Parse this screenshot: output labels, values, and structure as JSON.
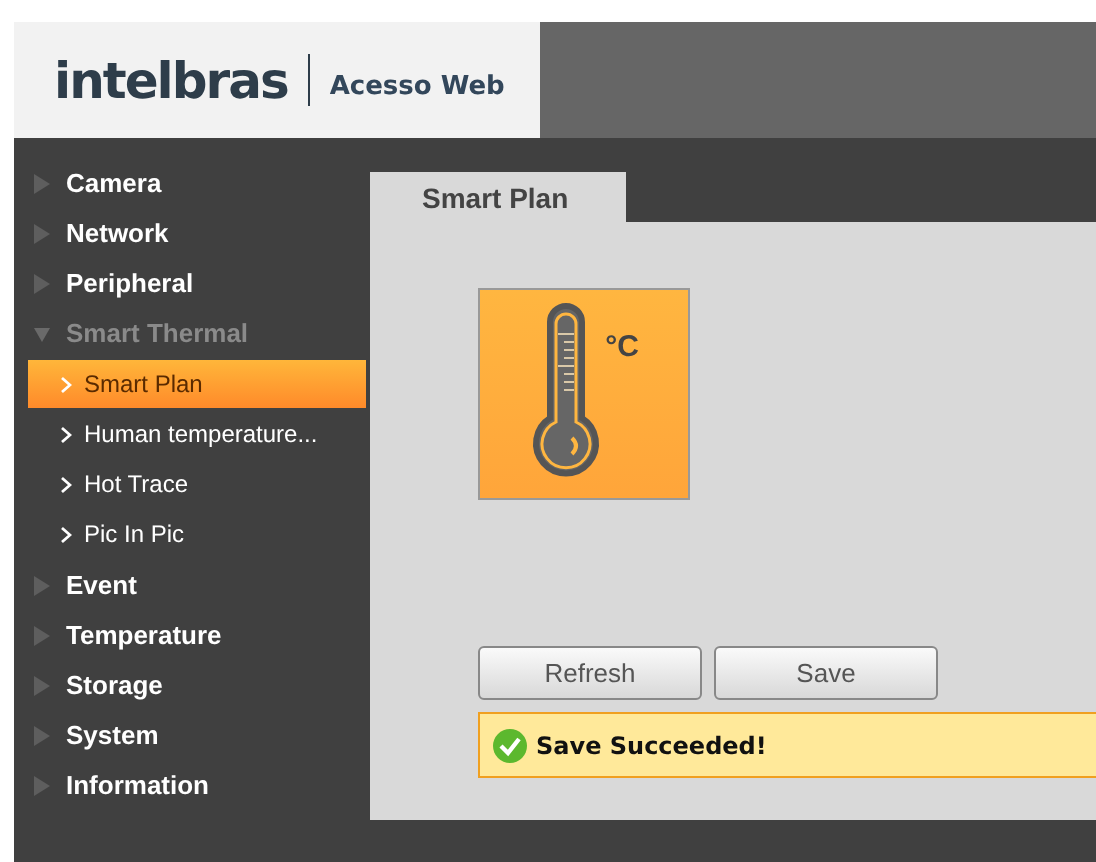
{
  "header": {
    "brand": "intelbras",
    "product": "Acesso Web"
  },
  "menu": [
    {
      "label": "Camera",
      "expanded": false
    },
    {
      "label": "Network",
      "expanded": false
    },
    {
      "label": "Peripheral",
      "expanded": false
    },
    {
      "label": "Smart Thermal",
      "expanded": true,
      "children": [
        {
          "label": "Smart Plan",
          "selected": true
        },
        {
          "label": "Human temperature...",
          "selected": false
        },
        {
          "label": "Hot Trace",
          "selected": false
        },
        {
          "label": "Pic In Pic",
          "selected": false
        }
      ]
    },
    {
      "label": "Event",
      "expanded": false
    },
    {
      "label": "Temperature",
      "expanded": false
    },
    {
      "label": "Storage",
      "expanded": false
    },
    {
      "label": "System",
      "expanded": false
    },
    {
      "label": "Information",
      "expanded": false
    }
  ],
  "tabs": [
    {
      "label": "Smart Plan",
      "selected": true
    }
  ],
  "plan_icon": {
    "unit": "°C"
  },
  "buttons": [
    "Refresh",
    "Save"
  ],
  "message": {
    "kind": "success",
    "text": "Save Succeeded!"
  }
}
